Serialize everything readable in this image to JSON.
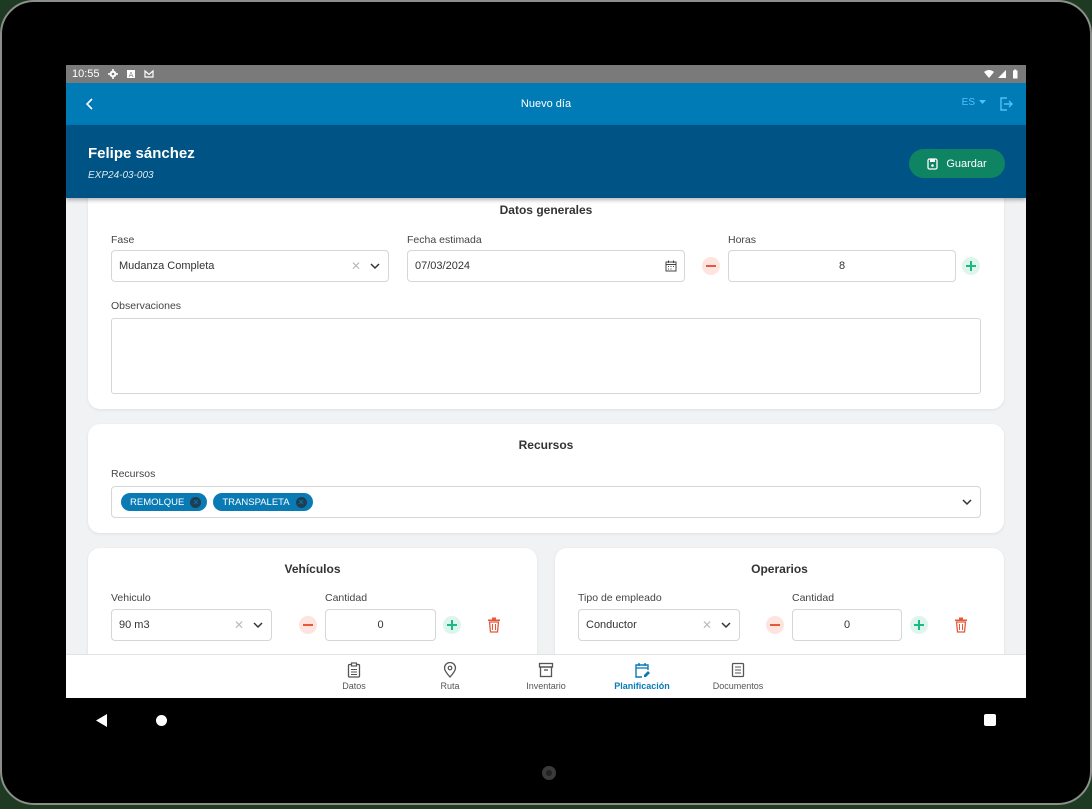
{
  "status_bar": {
    "time": "10:55",
    "icons_left": [
      "settings-icon",
      "a-badge-icon",
      "gmail-icon"
    ],
    "icons_right": [
      "wifi-icon",
      "signal-icon",
      "battery-icon"
    ]
  },
  "app_bar": {
    "title": "Nuevo día",
    "language": "ES"
  },
  "header": {
    "client_name": "Felipe sánchez",
    "expedient_code": "EXP24-03-003",
    "save_label": "Guardar"
  },
  "datos_generales": {
    "title": "Datos generales",
    "fase": {
      "label": "Fase",
      "value": "Mudanza Completa"
    },
    "fecha": {
      "label": "Fecha estimada",
      "value": "07/03/2024"
    },
    "horas": {
      "label": "Horas",
      "value": "8"
    },
    "observaciones": {
      "label": "Observaciones",
      "value": ""
    }
  },
  "recursos": {
    "title": "Recursos",
    "label": "Recursos",
    "chips": [
      "REMOLQUE",
      "TRANSPALETA"
    ]
  },
  "vehiculos": {
    "title": "Vehículos",
    "vehiculo_label": "Vehiculo",
    "vehiculo_value": "90 m3",
    "cantidad_label": "Cantidad",
    "cantidad_value": "0"
  },
  "operarios": {
    "title": "Operarios",
    "tipo_label": "Tipo de empleado",
    "tipo_value": "Conductor",
    "cantidad_label": "Cantidad",
    "cantidad_value": "0"
  },
  "bottom_nav": {
    "items": [
      {
        "label": "Datos",
        "icon": "clipboard-icon",
        "active": false
      },
      {
        "label": "Ruta",
        "icon": "map-pin-icon",
        "active": false
      },
      {
        "label": "Inventario",
        "icon": "archive-box-icon",
        "active": false
      },
      {
        "label": "Planificación",
        "icon": "calendar-edit-icon",
        "active": true
      },
      {
        "label": "Documentos",
        "icon": "document-icon",
        "active": false
      }
    ]
  },
  "colors": {
    "appbar": "#007bb6",
    "header": "#005485",
    "save_button": "#0e8463",
    "chip": "#0a7ab5",
    "minus": "#e5593b",
    "plus": "#1cb986",
    "trash": "#e5593b",
    "active_nav": "#0a7ab5"
  }
}
